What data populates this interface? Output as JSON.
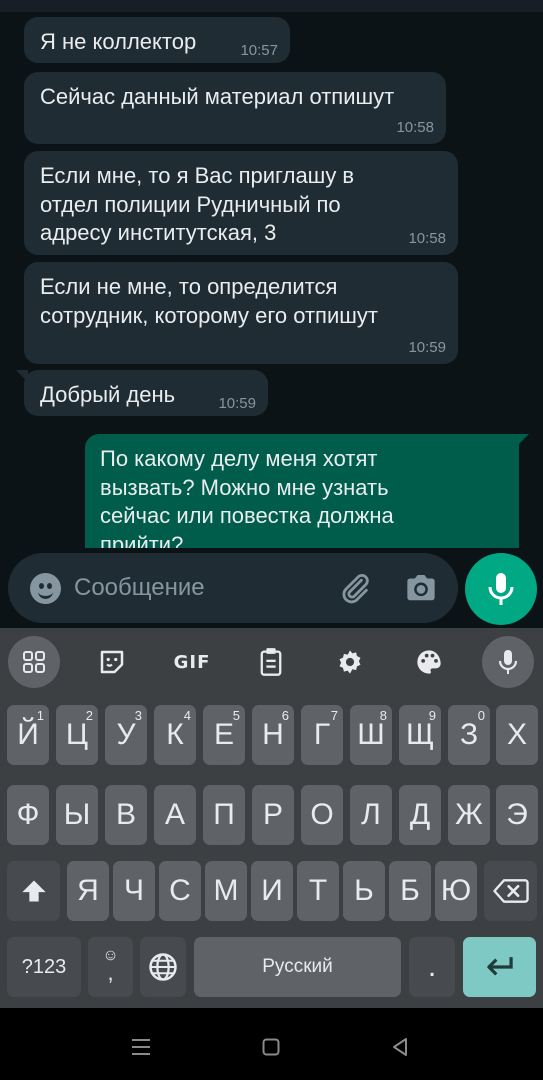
{
  "messages": [
    {
      "text": "Я не коллектор",
      "time": "10:57",
      "direction": "in"
    },
    {
      "text": "Сейчас данный материал отпишут",
      "time": "10:58",
      "direction": "in"
    },
    {
      "text": "Если мне, то я Вас приглашу в отдел полиции Рудничный по адресу институтская, 3",
      "time": "10:58",
      "direction": "in"
    },
    {
      "text": "Если не мне, то определится сотрудник, которому его отпишут",
      "time": "10:59",
      "direction": "in"
    },
    {
      "text": "Добрый день",
      "time": "10:59",
      "direction": "in"
    },
    {
      "text": "По какому делу меня хотят вызвать? Можно мне узнать сейчас или повестка должна прийти?",
      "time": "",
      "direction": "out"
    }
  ],
  "input": {
    "placeholder": "Сообщение"
  },
  "icons": {
    "emoji": "emoji-icon",
    "attach": "paperclip-icon",
    "camera": "camera-icon",
    "mic": "microphone-icon"
  },
  "keyboard": {
    "toolbar": [
      "apps-grid-icon",
      "sticker-icon",
      "GIF",
      "clipboard-icon",
      "settings-gear-icon",
      "palette-icon",
      "microphone-icon"
    ],
    "gif_label": "GIF",
    "row1": [
      {
        "k": "Й",
        "n": "1"
      },
      {
        "k": "Ц",
        "n": "2"
      },
      {
        "k": "У",
        "n": "3"
      },
      {
        "k": "К",
        "n": "4"
      },
      {
        "k": "Е",
        "n": "5"
      },
      {
        "k": "Н",
        "n": "6"
      },
      {
        "k": "Г",
        "n": "7"
      },
      {
        "k": "Ш",
        "n": "8"
      },
      {
        "k": "Щ",
        "n": "9"
      },
      {
        "k": "З",
        "n": "0"
      },
      {
        "k": "Х",
        "n": ""
      }
    ],
    "row2": [
      "Ф",
      "Ы",
      "В",
      "А",
      "П",
      "Р",
      "О",
      "Л",
      "Д",
      "Ж",
      "Э"
    ],
    "row3": [
      "Я",
      "Ч",
      "С",
      "М",
      "И",
      "Т",
      "Ь",
      "Б",
      "Ю"
    ],
    "symbols_key": "?123",
    "comma_key": ",",
    "space_label": "Русский",
    "period_key": "."
  },
  "colors": {
    "incoming_bubble": "#1f2c34",
    "outgoing_bubble": "#005c4b",
    "accent": "#00a884",
    "keyboard_bg": "#3c4043",
    "key_bg": "#5f6368",
    "enter_key": "#7ec9c3"
  }
}
